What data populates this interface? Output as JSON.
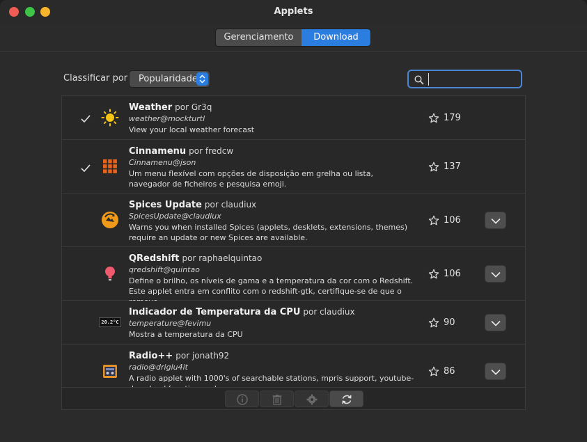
{
  "window": {
    "title": "Applets"
  },
  "tabs": [
    {
      "label": "Gerenciamento",
      "active": false
    },
    {
      "label": "Download",
      "active": true
    }
  ],
  "sort": {
    "label": "Classificar por",
    "value": "Popularidade"
  },
  "search": {
    "placeholder": "",
    "value": ""
  },
  "colors": {
    "accent": "#2c7de0",
    "background": "#2b2b2b",
    "row": "#282828"
  },
  "applets": [
    {
      "name": "Weather",
      "by": "por Gr3q",
      "uuid": "weather@mockturtl",
      "description": "View your local weather forecast",
      "score": "179",
      "installed": true,
      "icon": "sun-icon"
    },
    {
      "name": "Cinnamenu",
      "by": "por fredcw",
      "uuid": "Cinnamenu@json",
      "description": "Um menu flexível com opções de disposição em grelha ou lista, navegador de ficheiros e pesquisa emoji.",
      "score": "137",
      "installed": true,
      "icon": "grid-icon"
    },
    {
      "name": "Spices Update",
      "by": "por claudiux",
      "uuid": "SpicesUpdate@claudiux",
      "description": "Warns you when installed Spices (applets, desklets, extensions, themes) require an update or new Spices are available.",
      "score": "106",
      "installed": false,
      "icon": "update-icon"
    },
    {
      "name": "QRedshift",
      "by": "por raphaelquintao",
      "uuid": "qredshift@quintao",
      "description": "Define o brilho, os níveis de gama e a temperatura da cor com o Redshift. Este applet entra em conflito com o redshift-gtk, certifique-se de que o remove.",
      "score": "106",
      "installed": false,
      "icon": "bulb-icon"
    },
    {
      "name": "Indicador de Temperatura da CPU",
      "by": "por claudiux",
      "uuid": "temperature@fevimu",
      "description": "Mostra a temperatura da CPU",
      "score": "90",
      "installed": false,
      "icon": "temperature-icon",
      "icon_text": "20.2°C"
    },
    {
      "name": "Radio++",
      "by": "por jonath92",
      "uuid": "radio@driglu4it",
      "description": "A radio applet with 1000's of searchable stations, mpris support, youtube-download function and more.",
      "score": "86",
      "installed": false,
      "icon": "radio-icon"
    }
  ]
}
